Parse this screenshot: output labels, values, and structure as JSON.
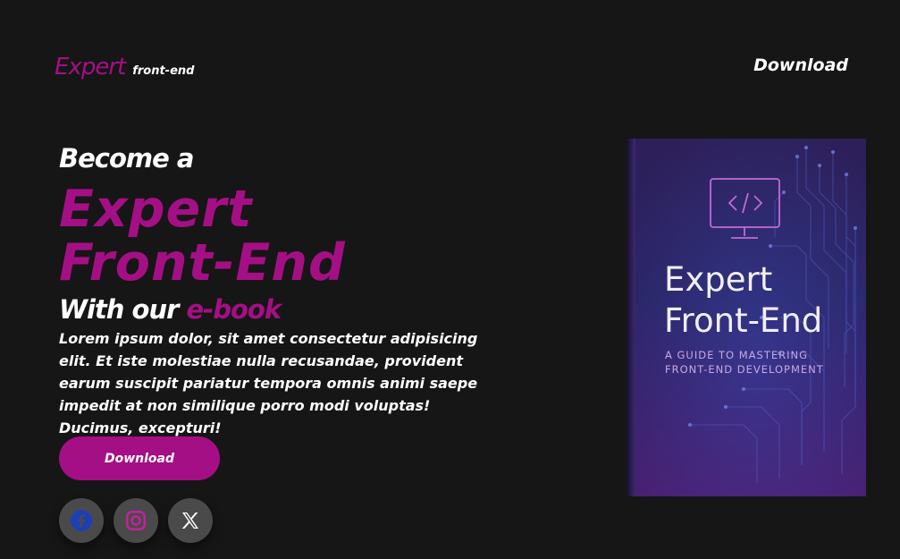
{
  "header": {
    "logo_main": "Expert",
    "logo_sub": "front-end",
    "nav_download": "Download"
  },
  "hero": {
    "become": "Become a",
    "title_line1": "Expert",
    "title_line2": "Front-End",
    "with_prefix": "With our",
    "with_accent": "e-book",
    "description": "Lorem ipsum dolor, sit amet consectetur adipisicing elit. Et iste molestiae nulla recusandae, provident earum suscipit pariatur tempora omnis animi saepe impedit at non similique porro modi voluptas! Ducimus, excepturi!",
    "download_button": "Download"
  },
  "socials": [
    {
      "icon": "facebook-icon"
    },
    {
      "icon": "instagram-icon"
    },
    {
      "icon": "x-icon"
    }
  ],
  "book": {
    "title_line1": "Expert",
    "title_line2": "Front-End",
    "subtitle_line1": "A GUIDE TO MASTERING",
    "subtitle_line2": "FRONT-END DEVELOPMENT"
  },
  "colors": {
    "background": "#161616",
    "accent": "#a50f85",
    "social_bg": "#4a4a4a",
    "facebook": "#1c3fb5",
    "instagram": "#c7209e"
  }
}
